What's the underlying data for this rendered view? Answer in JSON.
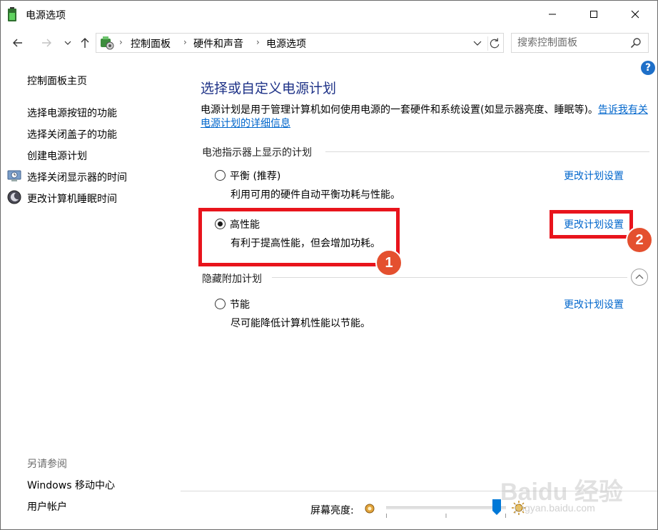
{
  "window": {
    "title": "电源选项"
  },
  "nav": {
    "breadcrumbs": [
      "控制面板",
      "硬件和声音",
      "电源选项"
    ],
    "search_placeholder": "搜索控制面板"
  },
  "left_pane": {
    "home": "控制面板主页",
    "links": [
      "选择电源按钮的功能",
      "选择关闭盖子的功能",
      "创建电源计划",
      "选择关闭显示器的时间",
      "更改计算机睡眠时间"
    ],
    "see_also_title": "另请参阅",
    "see_also": [
      "Windows 移动中心",
      "用户帐户"
    ]
  },
  "main": {
    "title": "选择或自定义电源计划",
    "description": "电源计划是用于管理计算机如何使用电源的一套硬件和系统设置(如显示器亮度、睡眠等)。",
    "description_link": "告诉我有关电源计划的详细信息",
    "battery_section": "电池指示器上显示的计划",
    "hidden_section": "隐藏附加计划",
    "plans": [
      {
        "name": "平衡 (推荐)",
        "desc": "利用可用的硬件自动平衡功耗与性能。",
        "link": "更改计划设置",
        "selected": false
      },
      {
        "name": "高性能",
        "desc": "有利于提高性能，但会增加功耗。",
        "link": "更改计划设置",
        "selected": true
      },
      {
        "name": "节能",
        "desc": "尽可能降低计算机性能以节能。",
        "link": "更改计划设置",
        "selected": false
      }
    ]
  },
  "annotations": {
    "badge1": "1",
    "badge2": "2"
  },
  "bottom": {
    "brightness_label": "屏幕亮度:",
    "brightness_level": 0.92
  },
  "watermark": {
    "main": "Baidu 经验",
    "sub": "jingyan.baidu.com"
  },
  "colors": {
    "title_blue": "#1e3287",
    "link_blue": "#0066cc",
    "highlight_red": "#e8141c",
    "badge_orange": "#e4502f"
  }
}
